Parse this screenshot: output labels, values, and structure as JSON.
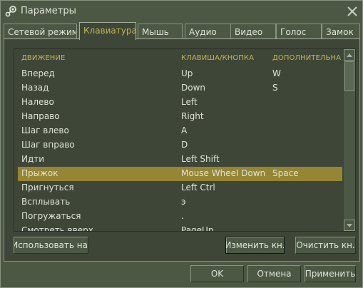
{
  "window": {
    "title": "Параметры",
    "icon": "steam-icon",
    "close_icon": "close-icon"
  },
  "tabs": [
    {
      "label": "Сетевой режим",
      "active": false
    },
    {
      "label": "Клавиатура",
      "active": true
    },
    {
      "label": "Мышь",
      "active": false
    },
    {
      "label": "Аудио",
      "active": false
    },
    {
      "label": "Видео",
      "active": false
    },
    {
      "label": "Голос",
      "active": false
    },
    {
      "label": "Замок",
      "active": false
    }
  ],
  "table": {
    "columns": [
      "ДВИЖЕНИЕ",
      "КЛАВИША/КНОПКА",
      "ДОПОЛНИТЕЛЬНАЯ"
    ],
    "rows": [
      {
        "action": "Вперед",
        "key": "Up",
        "alt": "W"
      },
      {
        "action": "Назад",
        "key": "Down",
        "alt": "S"
      },
      {
        "action": "Налево",
        "key": "Left",
        "alt": ""
      },
      {
        "action": "Направо",
        "key": "Right",
        "alt": ""
      },
      {
        "action": "Шаг влево",
        "key": "A",
        "alt": ""
      },
      {
        "action": "Шаг вправо",
        "key": "D",
        "alt": ""
      },
      {
        "action": "Идти",
        "key": "Left Shift",
        "alt": ""
      },
      {
        "action": "Прыжок",
        "key": "Mouse Wheel Down",
        "alt": "Space",
        "selected": true
      },
      {
        "action": "Пригнуться",
        "key": "Left Ctrl",
        "alt": ""
      },
      {
        "action": "Всплывать",
        "key": "э",
        "alt": ""
      },
      {
        "action": "Погружаться",
        "key": ".",
        "alt": ""
      },
      {
        "action": "Смотреть вверх",
        "key": "PageUp",
        "alt": ""
      }
    ]
  },
  "buttons": {
    "use_default": "Использовать на.",
    "change_key": "Изменить кн.",
    "clear_key": "Очистить кн.",
    "ok": "OK",
    "cancel": "Отмена",
    "apply": "Применить"
  },
  "colors": {
    "background": "#4c5844",
    "panel": "#3e4637",
    "accent": "#c4b550",
    "selection": "#968532"
  }
}
